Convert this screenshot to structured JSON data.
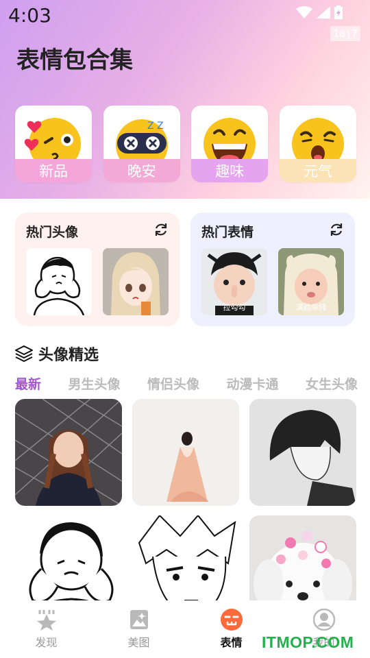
{
  "status_bar": {
    "time": "4:03",
    "build_tag": "1aj7"
  },
  "app_title": "表情包合集",
  "categories": [
    {
      "label": "新品",
      "label_color": "#f4a6da",
      "icon": "kiss-hearts-emoji-icon"
    },
    {
      "label": "晚安",
      "label_color": "#f3a9d6",
      "icon": "sleepy-mask-emoji-icon"
    },
    {
      "label": "趣味",
      "label_color": "#e6a3ef",
      "icon": "laughing-emoji-icon"
    },
    {
      "label": "元气",
      "label_color": "#fbe3b6",
      "icon": "yawning-emoji-icon"
    }
  ],
  "hot_panels": {
    "avatars": {
      "title": "热门头像",
      "icon": "refresh-icon"
    },
    "stickers": {
      "title": "热门表情",
      "icon": "refresh-icon",
      "captions": [
        "拉勾勾",
        "满脸单纯"
      ]
    }
  },
  "section": {
    "title": "头像精选",
    "icon": "layers-icon"
  },
  "tabs": [
    "最新",
    "男生头像",
    "情侣头像",
    "动漫卡通",
    "女生头像"
  ],
  "bottom_nav": [
    {
      "label": "发现",
      "icon": "star-icon",
      "active": false
    },
    {
      "label": "美图",
      "icon": "picture-icon",
      "active": false
    },
    {
      "label": "表情",
      "icon": "emoji-face-icon",
      "active": true
    },
    {
      "label": "我的",
      "icon": "profile-icon",
      "active": false
    }
  ],
  "watermark": "ITMOP.COM",
  "colors": {
    "accent": "#a256c9",
    "emoji_yellow": "#f9c31e",
    "nav_active": "#ff6a3d"
  }
}
